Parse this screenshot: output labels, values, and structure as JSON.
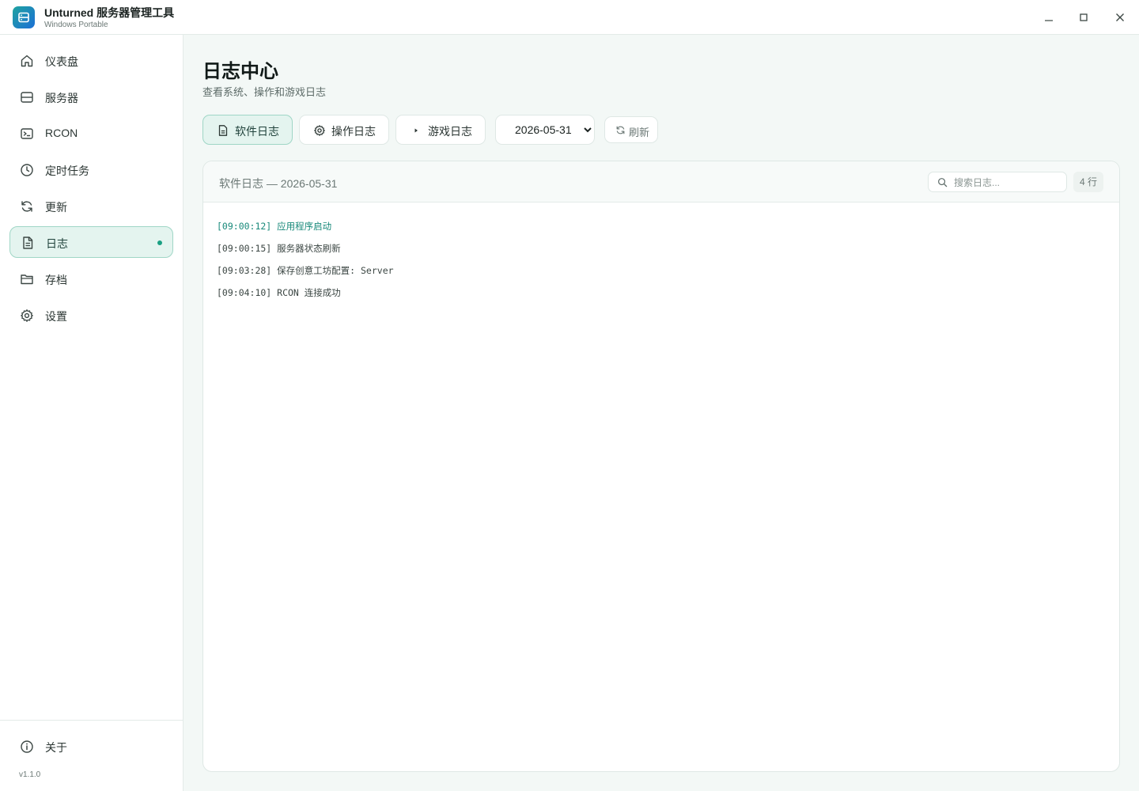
{
  "window": {
    "title": "Unturned 服务器管理工具",
    "subtitle": "Windows Portable"
  },
  "sidebar": {
    "items": [
      {
        "label": "仪表盘",
        "icon": "home-icon"
      },
      {
        "label": "服务器",
        "icon": "server-icon"
      },
      {
        "label": "RCON",
        "icon": "terminal-icon"
      },
      {
        "label": "定时任务",
        "icon": "clock-icon"
      },
      {
        "label": "更新",
        "icon": "refresh-icon"
      },
      {
        "label": "日志",
        "icon": "document-icon",
        "active": true
      },
      {
        "label": "存档",
        "icon": "folder-icon"
      },
      {
        "label": "设置",
        "icon": "gear-icon"
      }
    ],
    "about_label": "关于",
    "version": "v1.1.0"
  },
  "page": {
    "title": "日志中心",
    "subtitle": "查看系统、操作和游戏日志"
  },
  "toolbar": {
    "tabs": [
      {
        "label": "软件日志",
        "icon": "document-icon",
        "active": true
      },
      {
        "label": "操作日志",
        "icon": "gear-icon"
      },
      {
        "label": "游戏日志",
        "icon": "play-icon"
      }
    ],
    "date_value": "2026-05-31",
    "refresh_label": "刷新"
  },
  "log_panel": {
    "header_title": "软件日志 — 2026-05-31",
    "search_placeholder": "搜索日志...",
    "line_count": "4 行",
    "lines": [
      {
        "text": "[09:00:12] 应用程序启动",
        "highlight": true
      },
      {
        "text": "[09:00:15] 服务器状态刷新",
        "highlight": false
      },
      {
        "text": "[09:03:28] 保存创意工坊配置: Server",
        "highlight": false
      },
      {
        "text": "[09:04:10] RCON 连接成功",
        "highlight": false
      }
    ]
  },
  "colors": {
    "accent": "#1aa083",
    "active_bg": "#e4f4ef",
    "active_border": "#9fd6c6",
    "page_bg": "#f3f8f6"
  }
}
